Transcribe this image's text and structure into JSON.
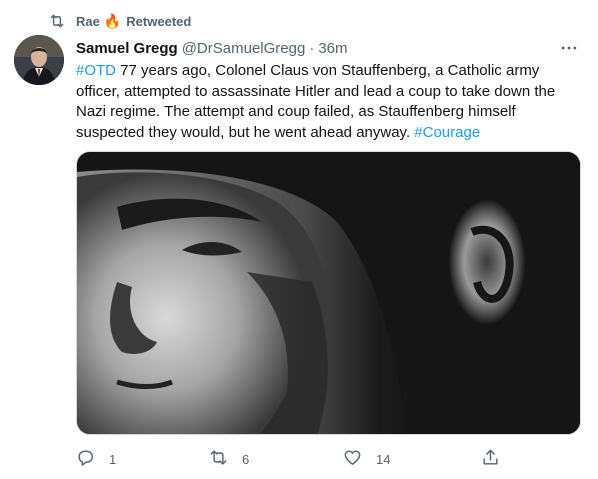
{
  "retweet_banner": {
    "user": "Rae",
    "emoji": "🔥",
    "label": "Retweeted"
  },
  "tweet": {
    "author_name": "Samuel Gregg",
    "author_handle": "@DrSamuelGregg",
    "separator": "·",
    "time": "36m",
    "text_parts": {
      "tag1": "#OTD",
      "body": " 77 years ago, Colonel Claus von Stauffenberg, a Catholic army officer, attempted to assassinate Hitler and lead a coup to take down the Nazi regime. The attempt and coup failed, as Stauffenberg himself suspected they would, but he went ahead anyway. ",
      "tag2": "#Courage"
    },
    "more_label": "···"
  },
  "actions": {
    "reply_count": "1",
    "retweet_count": "6",
    "like_count": "14"
  },
  "colors": {
    "accent": "#1d9bf0",
    "secondary_text": "#536471",
    "retweet_icon": "#536471"
  },
  "icons": {
    "retweet_banner": "retweet-icon",
    "reply": "reply-icon",
    "retweet": "retweet-icon",
    "like": "heart-icon",
    "share": "share-icon",
    "more": "more-icon"
  }
}
